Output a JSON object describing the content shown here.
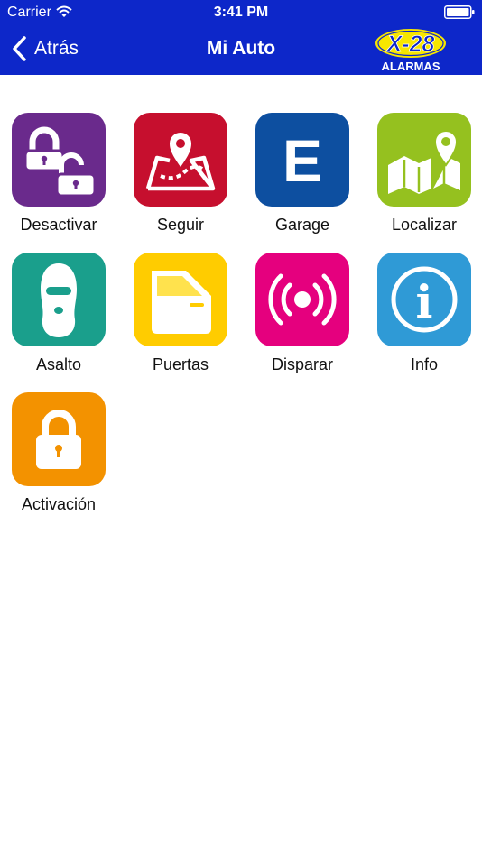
{
  "status_bar": {
    "carrier": "Carrier",
    "time": "3:41 PM"
  },
  "nav": {
    "back_label": "Atrás",
    "title": "Mi Auto"
  },
  "logo": {
    "line1": "X-28",
    "line2": "ALARMAS"
  },
  "colors": {
    "nav_bg": "#0d27c9",
    "desactivar": "#6a2a8c",
    "seguir": "#c60f2e",
    "garage": "#0d4fa0",
    "localizar": "#95c11f",
    "asalto": "#1a9f8c",
    "puertas": "#ffcc00",
    "disparar": "#e5007e",
    "info": "#2f9ad6",
    "activacion": "#f39200"
  },
  "tiles": [
    {
      "label": "Desactivar",
      "icon": "two-padlocks-icon"
    },
    {
      "label": "Seguir",
      "icon": "route-map-icon"
    },
    {
      "label": "Garage",
      "icon": "garage-e-icon",
      "glyph": "E"
    },
    {
      "label": "Localizar",
      "icon": "location-map-icon"
    },
    {
      "label": "Asalto",
      "icon": "balaclava-icon"
    },
    {
      "label": "Puertas",
      "icon": "car-door-icon"
    },
    {
      "label": "Disparar",
      "icon": "broadcast-icon"
    },
    {
      "label": "Info",
      "icon": "info-icon",
      "glyph": "i"
    },
    {
      "label": "Activación",
      "icon": "padlock-icon"
    }
  ]
}
